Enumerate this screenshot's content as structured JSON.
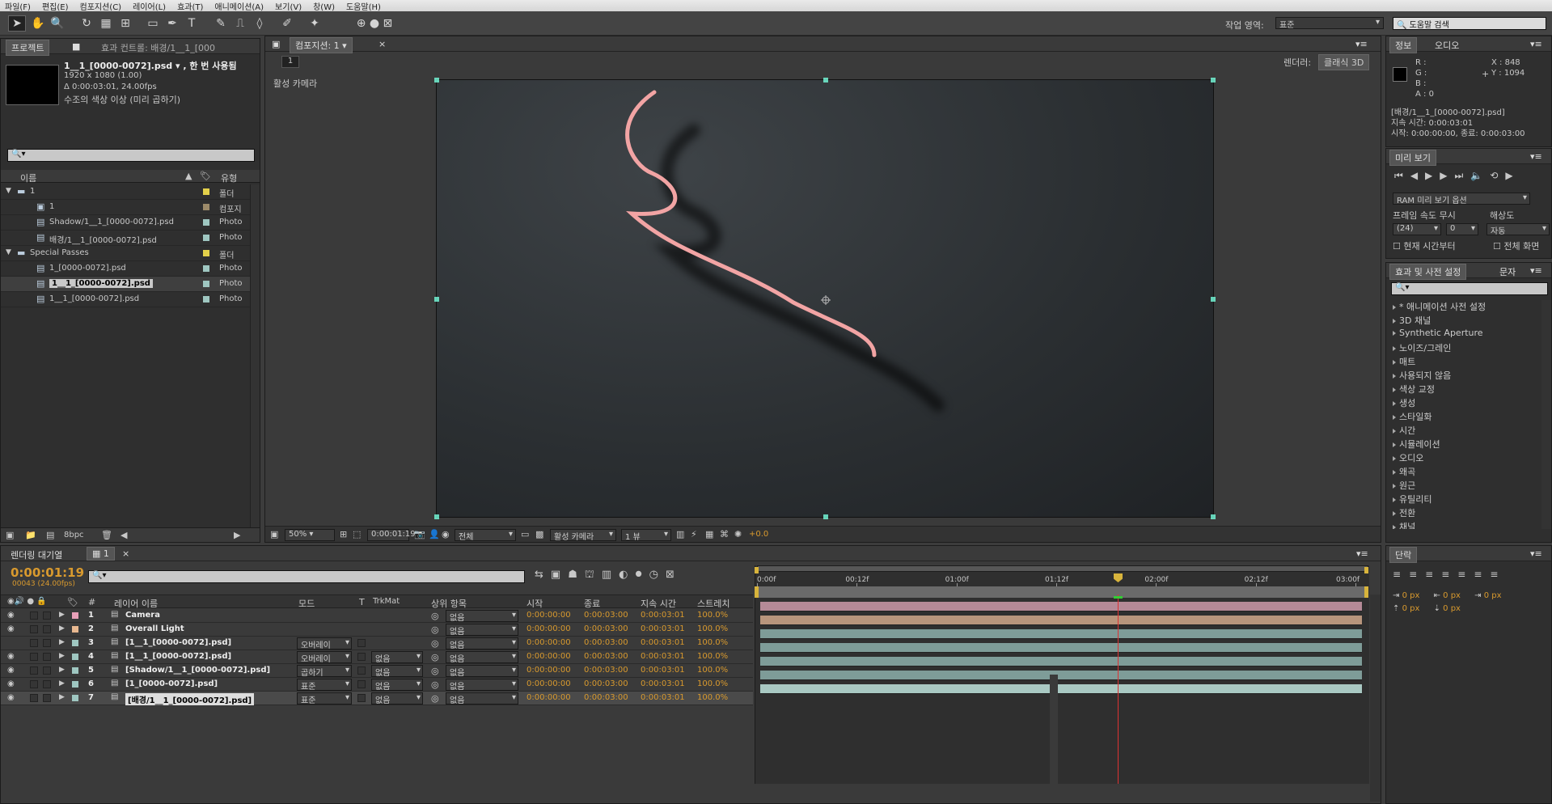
{
  "menu": [
    "파일(F)",
    "편집(E)",
    "컴포지션(C)",
    "레이어(L)",
    "효과(T)",
    "애니메이션(A)",
    "보기(V)",
    "창(W)",
    "도움말(H)"
  ],
  "workspace": {
    "label": "작업 영역:",
    "value": "표준",
    "help_placeholder": "도움말 검색"
  },
  "project": {
    "tab_project": "프로젝트",
    "tab_effects": "효과 컨트롤: 배경/1__1_[000",
    "file_name": "1__1_[0000-0072].psd ▾ , 한 번 사용됨",
    "dims": "1920 x 1080 (1.00)",
    "duration": "Δ 0:00:03:01, 24.00fps",
    "desc": "수조의 색상 이상 (미리 곱하기)",
    "col_name": "이름",
    "col_type": "유형",
    "items": [
      {
        "name": "1",
        "type": "폴더",
        "level": 0,
        "kind": "folder",
        "color": "#e3d04a"
      },
      {
        "name": "1",
        "type": "컴포지",
        "level": 1,
        "kind": "comp",
        "color": "#9d8b6a"
      },
      {
        "name": "Shadow/1__1_[0000-0072].psd",
        "type": "Photo",
        "level": 1,
        "kind": "psd",
        "color": "#9fc7c1"
      },
      {
        "name": "배경/1__1_[0000-0072].psd",
        "type": "Photo",
        "level": 1,
        "kind": "psd",
        "color": "#9fc7c1"
      },
      {
        "name": "Special Passes",
        "type": "폴더",
        "level": 0,
        "kind": "folder",
        "color": "#e3d04a"
      },
      {
        "name": "1_[0000-0072].psd",
        "type": "Photo",
        "level": 1,
        "kind": "psd",
        "color": "#9fc7c1"
      },
      {
        "name": "1__1_[0000-0072].psd",
        "type": "Photo",
        "level": 1,
        "kind": "psd",
        "color": "#9fc7c1",
        "selected": true
      },
      {
        "name": "1__1_[0000-0072].psd",
        "type": "Photo",
        "level": 1,
        "kind": "psd",
        "color": "#9fc7c1"
      }
    ],
    "bpc": "8bpc"
  },
  "comp": {
    "tab": "컴포지션: 1",
    "crumb": "1",
    "renderer_label": "렌더러:",
    "renderer": "클래식 3D",
    "active_camera": "활성 카메라",
    "zoom": "50%",
    "time": "0:00:01:19",
    "res": "전체",
    "view": "활성 카메라",
    "views": "1 뷰",
    "exposure": "+0.0"
  },
  "info": {
    "tab_info": "정보",
    "tab_audio": "오디오",
    "r": "R :",
    "g": "G :",
    "b": "B :",
    "a": "A : 0",
    "x": "X : 848",
    "y": "Y : 1094",
    "file": "[배경/1__1_[0000-0072].psd]",
    "dur": "지속 시간: 0:00:03:01",
    "range": "시작: 0:00:00:00, 종료: 0:00:03:00"
  },
  "preview": {
    "tab": "미리 보기",
    "ram": "RAM 미리 보기 옵션",
    "fps_label": "프레임 속도",
    "skip_label": "무시",
    "res_label": "해상도",
    "fps": "(24)",
    "skip": "0",
    "res": "자동",
    "from_current": "현재 시간부터",
    "full": "전체 화면"
  },
  "effects": {
    "tab": "효과 및 사전 설정",
    "tab2": "문자",
    "items": [
      "* 애니메이션 사전 설정",
      "3D 채널",
      "Synthetic Aperture",
      "노이즈/그레인",
      "매트",
      "사용되지 않음",
      "색상 교정",
      "생성",
      "스타일화",
      "시간",
      "시뮬레이션",
      "오디오",
      "왜곡",
      "원근",
      "유틸리티",
      "전환",
      "채널"
    ]
  },
  "paragraph": {
    "tab": "단락",
    "px1": "0 px",
    "px2": "0 px",
    "px3": "0 px",
    "px4": "0 px",
    "px5": "0 px"
  },
  "timeline": {
    "tab_render": "렌더링 대기열",
    "tab_comp": "1",
    "timecode": "0:00:01:19",
    "frames": "00043 (24.00fps)",
    "ruler": [
      "0:00f",
      "00:12f",
      "01:00f",
      "01:12f",
      "02:00f",
      "02:12f",
      "03:00f"
    ],
    "headers": {
      "num": "#",
      "name": "레이어 이름",
      "mode": "모드",
      "t": "T",
      "trkmat": "TrkMat",
      "parent": "상위 항목",
      "in": "시작",
      "out": "종료",
      "dur": "지속 시간",
      "stretch": "스트레치"
    },
    "layers": [
      {
        "n": "1",
        "name": "Camera",
        "mode": "",
        "trk": "",
        "parent": "없음",
        "in": "0:00:00:00",
        "out": "0:00:03:00",
        "dur": "0:00:03:01",
        "st": "100.0%",
        "color": "#e8a0b8",
        "bar": "#b58a97",
        "eye": true
      },
      {
        "n": "2",
        "name": "Overall Light",
        "mode": "",
        "trk": "",
        "parent": "없음",
        "in": "0:00:00:00",
        "out": "0:00:03:00",
        "dur": "0:00:03:01",
        "st": "100.0%",
        "color": "#e8b890",
        "bar": "#b8957c",
        "eye": true
      },
      {
        "n": "3",
        "name": "[1__1_[0000-0072].psd]",
        "mode": "오버레이",
        "trk": "",
        "parent": "없음",
        "in": "0:00:00:00",
        "out": "0:00:03:00",
        "dur": "0:00:03:01",
        "st": "100.0%",
        "color": "#9fc7c1",
        "bar": "#7e9c98",
        "eye": false
      },
      {
        "n": "4",
        "name": "[1__1_[0000-0072].psd]",
        "mode": "오버레이",
        "trk": "없음",
        "parent": "없음",
        "in": "0:00:00:00",
        "out": "0:00:03:00",
        "dur": "0:00:03:01",
        "st": "100.0%",
        "color": "#9fc7c1",
        "bar": "#7e9c98",
        "eye": true
      },
      {
        "n": "5",
        "name": "[Shadow/1__1_[0000-0072].psd]",
        "mode": "곱하기",
        "trk": "없음",
        "parent": "없음",
        "in": "0:00:00:00",
        "out": "0:00:03:00",
        "dur": "0:00:03:01",
        "st": "100.0%",
        "color": "#9fc7c1",
        "bar": "#7e9c98",
        "eye": true
      },
      {
        "n": "6",
        "name": "[1_[0000-0072].psd]",
        "mode": "표준",
        "trk": "없음",
        "parent": "없음",
        "in": "0:00:00:00",
        "out": "0:00:03:00",
        "dur": "0:00:03:01",
        "st": "100.0%",
        "color": "#9fc7c1",
        "bar": "#7e9c98",
        "eye": true
      },
      {
        "n": "7",
        "name": "[배경/1__1_[0000-0072].psd]",
        "mode": "표준",
        "trk": "없음",
        "parent": "없음",
        "in": "0:00:00:00",
        "out": "0:00:03:00",
        "dur": "0:00:03:01",
        "st": "100.0%",
        "color": "#9fc7c1",
        "bar": "#a9c9c3",
        "eye": true,
        "selected": true
      }
    ]
  }
}
